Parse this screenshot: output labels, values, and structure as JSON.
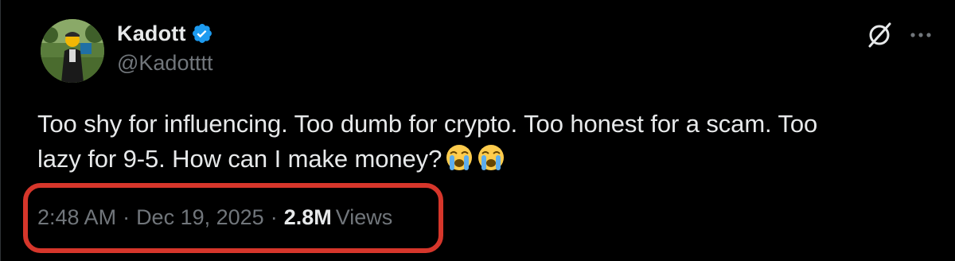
{
  "tweet": {
    "author": {
      "display_name": "Kadott",
      "handle": "@Kadotttt",
      "verified": true
    },
    "text_line1": "Too shy for influencing. Too dumb for crypto. Too honest for a scam. Too",
    "text_line2": "lazy for 9-5. How can I make money?",
    "emojis": [
      "loudly-crying-face",
      "loudly-crying-face"
    ],
    "time": "2:48 AM",
    "date": "Dec 19, 2025",
    "separator": "·",
    "views_count": "2.8M",
    "views_label": "Views"
  },
  "icons": {
    "grok": "grok-icon",
    "more": "more-options-icon",
    "verified": "verified-badge-icon"
  },
  "colors": {
    "background": "#000000",
    "text_primary": "#e7e9ea",
    "text_secondary": "#71767b",
    "verified_blue": "#1d9bf0",
    "highlight_red": "#d6362b"
  }
}
